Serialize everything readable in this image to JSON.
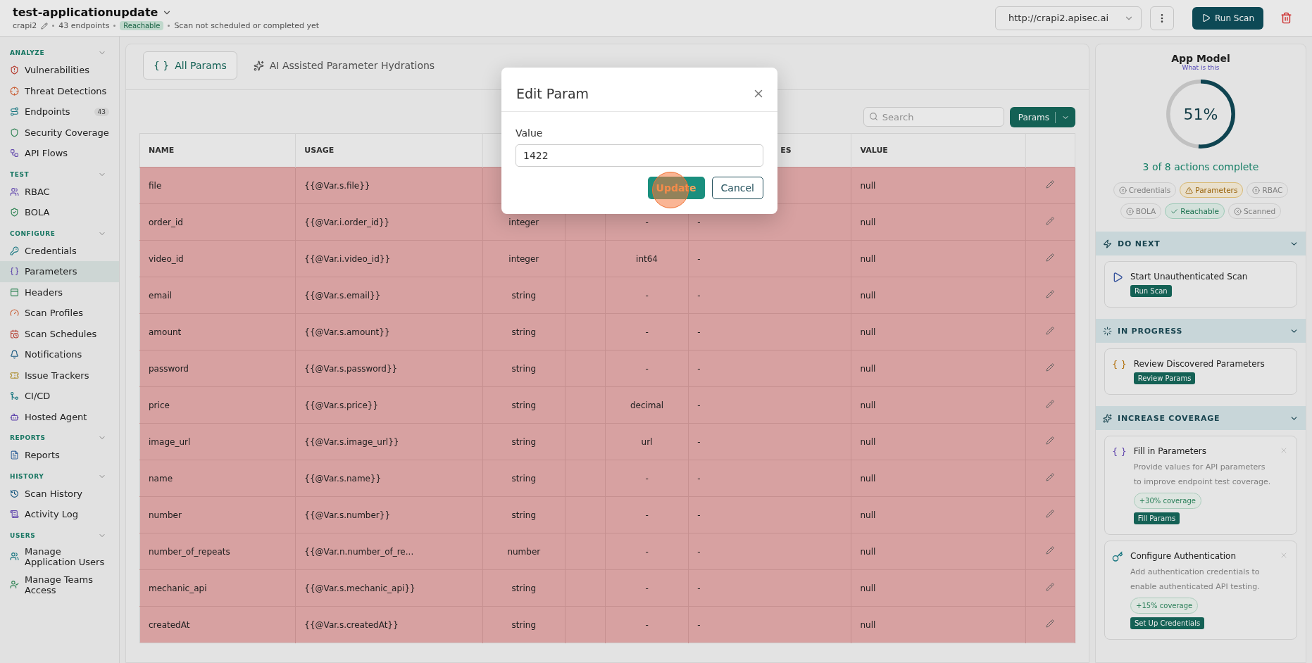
{
  "header": {
    "title": "test-applicationupdate",
    "app_name": "crapi2",
    "endpoints": "43 endpoints",
    "status_badge": "Reachable",
    "scan_status": "Scan not scheduled or completed yet",
    "url": "http://crapi2.apisec.ai",
    "run_scan": "Run Scan"
  },
  "sidebar": {
    "sections": [
      {
        "title": "ANALYZE",
        "items": [
          {
            "label": "Vulnerabilities",
            "selected": false
          },
          {
            "label": "Threat Detections",
            "selected": false
          },
          {
            "label": "Endpoints",
            "count": "43",
            "selected": false
          },
          {
            "label": "Security Coverage",
            "selected": false
          },
          {
            "label": "API Flows",
            "selected": false
          }
        ]
      },
      {
        "title": "TEST",
        "items": [
          {
            "label": "RBAC",
            "selected": false
          },
          {
            "label": "BOLA",
            "selected": false
          }
        ]
      },
      {
        "title": "CONFIGURE",
        "items": [
          {
            "label": "Credentials",
            "selected": false
          },
          {
            "label": "Parameters",
            "selected": true
          },
          {
            "label": "Headers",
            "selected": false
          },
          {
            "label": "Scan Profiles",
            "selected": false
          },
          {
            "label": "Scan Schedules",
            "selected": false
          },
          {
            "label": "Notifications",
            "selected": false
          },
          {
            "label": "Issue Trackers",
            "selected": false
          },
          {
            "label": "CI/CD",
            "selected": false
          },
          {
            "label": "Hosted Agent",
            "selected": false
          }
        ]
      },
      {
        "title": "REPORTS",
        "items": [
          {
            "label": "Reports",
            "selected": false
          }
        ]
      },
      {
        "title": "HISTORY",
        "items": [
          {
            "label": "Scan History",
            "selected": false
          },
          {
            "label": "Activity Log",
            "selected": false
          }
        ]
      },
      {
        "title": "USERS",
        "items": [
          {
            "label": "Manage Application Users",
            "selected": false
          },
          {
            "label": "Manage Teams Access",
            "selected": false
          }
        ]
      }
    ]
  },
  "tabs": [
    {
      "icon": "{ }",
      "label": "All Params",
      "selected": true
    },
    {
      "label": "AI Assisted Parameter Hydrations",
      "selected": false
    }
  ],
  "search": {
    "placeholder": "Search"
  },
  "params_button": "Params",
  "table": {
    "columns": [
      {
        "label": "NAME"
      },
      {
        "label": "USAGE"
      },
      {},
      {},
      {},
      {
        "label": "ES"
      },
      {
        "label": "VALUE"
      },
      {}
    ],
    "rows": [
      {
        "name": "file",
        "usage": "{{@Var.s.file}}",
        "value": "null"
      },
      {
        "name": "order_id",
        "usage": "{{@Var.i.order_id}}",
        "type": "integer",
        "format": "-",
        "column_6": "-",
        "value": "null"
      },
      {
        "name": "video_id",
        "usage": "{{@Var.i.video_id}}",
        "type": "integer",
        "format": "int64",
        "column_6": "-",
        "value": "null"
      },
      {
        "name": "email",
        "usage": "{{@Var.s.email}}",
        "type": "string",
        "format": "-",
        "column_6": "-",
        "value": "null"
      },
      {
        "name": "amount",
        "usage": "{{@Var.s.amount}}",
        "type": "string",
        "format": "-",
        "column_6": "-",
        "value": "null"
      },
      {
        "name": "password",
        "usage": "{{@Var.s.password}}",
        "type": "string",
        "format": "-",
        "column_6": "-",
        "value": "null"
      },
      {
        "name": "price",
        "usage": "{{@Var.s.price}}",
        "type": "string",
        "format": "decimal",
        "column_6": "-",
        "value": "null"
      },
      {
        "name": "image_url",
        "usage": "{{@Var.s.image_url}}",
        "type": "string",
        "format": "url",
        "column_6": "-",
        "value": "null"
      },
      {
        "name": "name",
        "usage": "{{@Var.s.name}}",
        "type": "string",
        "format": "-",
        "column_6": "-",
        "value": "null"
      },
      {
        "name": "number",
        "usage": "{{@Var.s.number}}",
        "type": "string",
        "format": "-",
        "column_6": "-",
        "value": "null"
      },
      {
        "name": "number_of_repeats",
        "usage": "{{@Var.n.number_of_re...",
        "type": "number",
        "format": "-",
        "column_6": "-",
        "value": "null"
      },
      {
        "name": "mechanic_api",
        "usage": "{{@Var.s.mechanic_api}}",
        "type": "string",
        "format": "-",
        "column_6": "-",
        "value": "null"
      },
      {
        "name": "createdAt",
        "usage": "{{@Var.s.createdAt}}",
        "type": "string",
        "format": "-",
        "column_6": "-",
        "value": "null"
      }
    ]
  },
  "app_model": {
    "title": "App Model",
    "link": "What is this",
    "level": 0.51,
    "percent": "51%",
    "summary": "3 of 8 actions complete",
    "chips": [
      {
        "label": "Credentials",
        "kind": "missing"
      },
      {
        "label": "Parameters",
        "kind": "warning"
      },
      {
        "label": "RBAC",
        "kind": "missing"
      },
      {
        "label": "BOLA",
        "kind": "missing"
      },
      {
        "label": "Reachable",
        "kind": "done"
      },
      {
        "label": "Scanned",
        "kind": "missing"
      }
    ],
    "sections": [
      {
        "title": "DO NEXT",
        "expanded": true,
        "cards": [
          {
            "title": "Start Unauthenticated Scan",
            "action": "Run Scan"
          }
        ]
      },
      {
        "title": "IN PROGRESS",
        "expanded": true,
        "cards": [
          {
            "title": "Review Discovered Parameters",
            "action": "Review Params"
          }
        ]
      },
      {
        "title": "INCREASE COVERAGE",
        "expanded": true,
        "cards": [
          {
            "title": "Fill in Parameters",
            "description": "Provide values for API parameters to improve endpoint test coverage.",
            "coverage": "+30% coverage",
            "action": "Fill Params"
          },
          {
            "title": "Configure Authentication",
            "description": "Add authentication credentials to enable authenticated API testing.",
            "coverage": "+15% coverage",
            "action": "Set Up Credentials"
          }
        ]
      }
    ]
  },
  "dialog": {
    "title": "Edit Param",
    "field_label": "Value",
    "value": "1422",
    "primary": "Update",
    "secondary": "Cancel"
  }
}
